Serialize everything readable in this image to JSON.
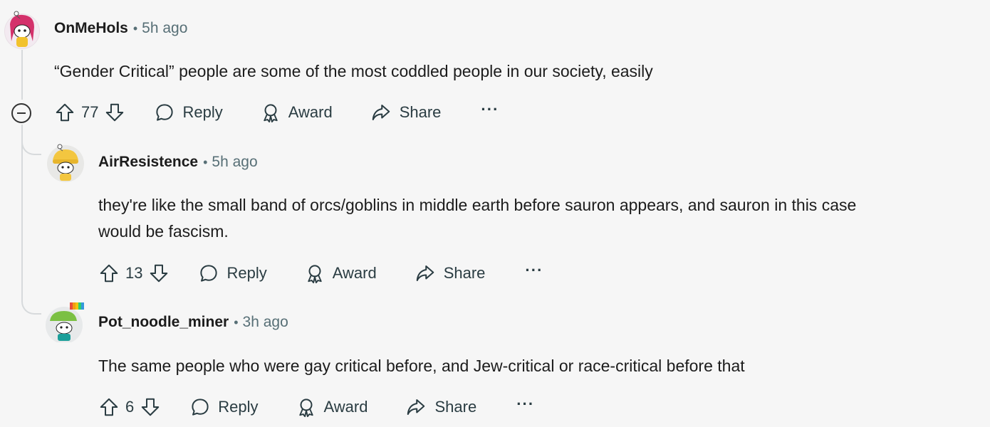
{
  "comments": [
    {
      "author": "OnMeHols",
      "separator": "•",
      "time": "5h ago",
      "body": [
        "“Gender Critical” people are some of the most coddled people in our society, easily"
      ],
      "votes": "77",
      "reply": "Reply",
      "award": "Award",
      "share": "Share",
      "more": "···"
    },
    {
      "author": "AirResistence",
      "separator": "•",
      "time": "5h ago",
      "body": [
        "they're like the small band of orcs/goblins in middle earth before sauron appears, and sauron in this case",
        "would be fascism."
      ],
      "votes": "13",
      "reply": "Reply",
      "award": "Award",
      "share": "Share",
      "more": "···"
    },
    {
      "author": "Pot_noodle_miner",
      "separator": "•",
      "time": "3h ago",
      "body": [
        "The same people who were gay critical before, and Jew-critical or race-critical before that"
      ],
      "votes": "6",
      "reply": "Reply",
      "award": "Award",
      "share": "Share",
      "more": "···"
    }
  ],
  "icons": {
    "upvote": "upvote-icon",
    "downvote": "downvote-icon",
    "reply": "reply-icon",
    "award": "award-icon",
    "share": "share-icon",
    "more": "more-icon",
    "collapse": "collapse-icon"
  },
  "colors": {
    "background": "#f6f6f6",
    "text": "#1c1c1c",
    "meta": "#576f76",
    "threadline": "#d7dadc"
  }
}
